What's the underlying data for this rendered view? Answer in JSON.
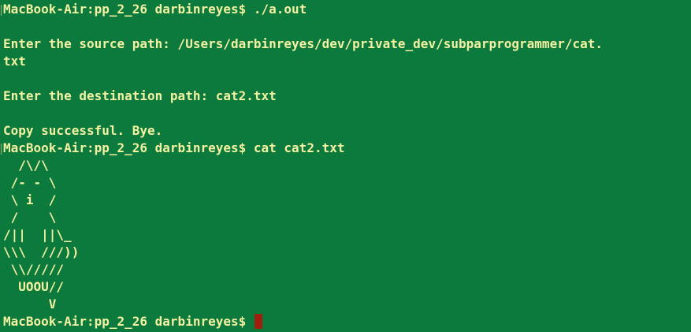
{
  "colors": {
    "background": "#0b7a3c",
    "text": "#f3f1a2",
    "cursor": "#a0200f"
  },
  "terminal": {
    "lines": [
      "MacBook-Air:pp_2_26 darbinreyes$ ./a.out",
      "",
      "Enter the source path: /Users/darbinreyes/dev/private_dev/subparprogrammer/cat.",
      "txt",
      "",
      "Enter the destination path: cat2.txt",
      "",
      "Copy successful. Bye.",
      "MacBook-Air:pp_2_26 darbinreyes$ cat cat2.txt",
      "  /\\/\\",
      " /- - \\",
      " \\ i  /",
      " /    \\",
      "/||  ||\\_",
      "\\\\\\  ///))",
      " \\\\/////",
      "  UOOU//",
      "      V",
      "MacBook-Air:pp_2_26 darbinreyes$ "
    ]
  }
}
